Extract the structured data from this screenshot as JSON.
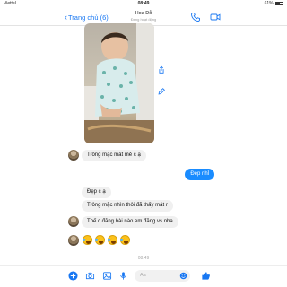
{
  "status_bar": {
    "carrier": "Viettel",
    "time": "08:49",
    "battery": "61%",
    "battery_level": 0.61
  },
  "header": {
    "back_label": "Trang chủ (6)",
    "contact_name": "Hoa Đỗ",
    "contact_status": "Đang hoạt động"
  },
  "messages": [
    {
      "side": "in",
      "text": "Trông mặc mát mẻ c ạ"
    },
    {
      "side": "out",
      "text": "Đẹp nhỉ"
    },
    {
      "side": "in",
      "text": "Đẹp c ạ"
    },
    {
      "side": "in",
      "text": "Trông mặc nhìn thôi đã thấy mát r"
    },
    {
      "side": "in",
      "text": "Thế c đăng bài nào em đăng vs nha"
    }
  ],
  "emoji_reply": [
    "😂",
    "😂",
    "😂",
    "😂"
  ],
  "timestamp": "08:49",
  "composer": {
    "placeholder": "Aa"
  },
  "colors": {
    "accent": "#1877f2",
    "out_bubble": "#1a8cff",
    "in_bubble": "#f0f0f0"
  }
}
